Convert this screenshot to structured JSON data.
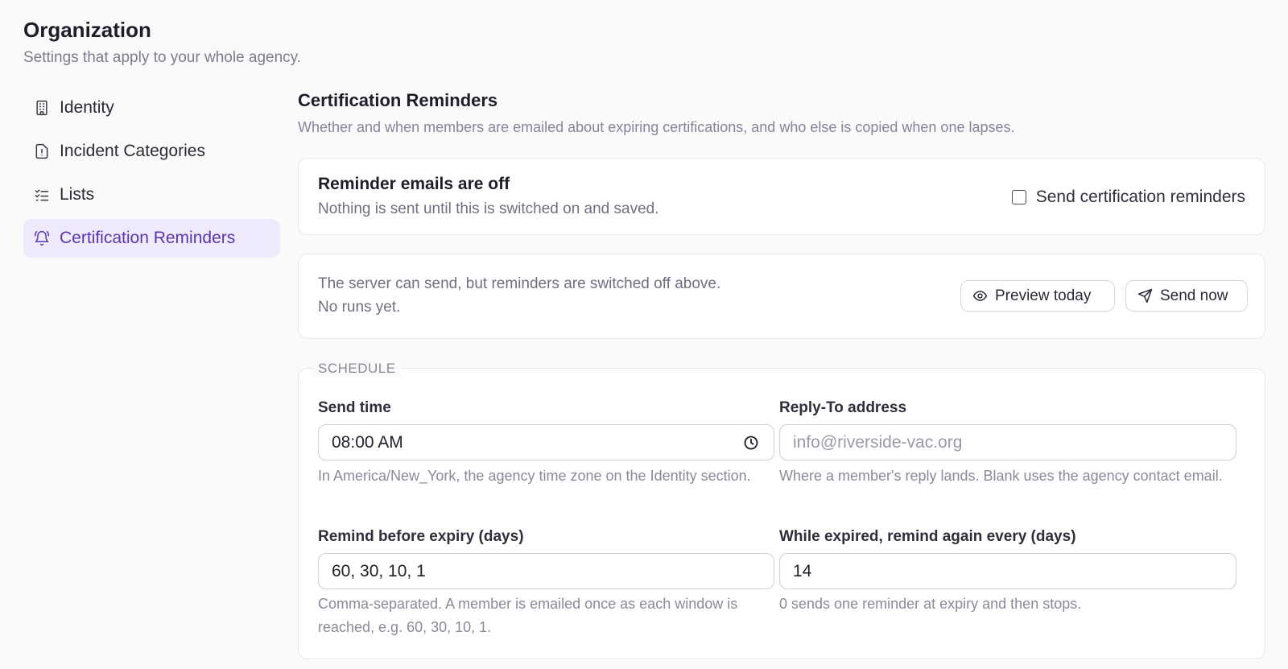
{
  "header": {
    "title": "Organization",
    "subtitle": "Settings that apply to your whole agency."
  },
  "sidebar": {
    "items": [
      {
        "label": "Identity",
        "icon": "building-icon",
        "active": false
      },
      {
        "label": "Incident Categories",
        "icon": "file-alert-icon",
        "active": false
      },
      {
        "label": "Lists",
        "icon": "list-checks-icon",
        "active": false
      },
      {
        "label": "Certification Reminders",
        "icon": "bell-ring-icon",
        "active": true
      }
    ]
  },
  "section": {
    "title": "Certification Reminders",
    "description": "Whether and when members are emailed about expiring certifications, and who else is copied when one lapses."
  },
  "status_card": {
    "title": "Reminder emails are off",
    "description": "Nothing is sent until this is switched on and saved.",
    "toggle_label": "Send certification reminders",
    "toggle_checked": false
  },
  "run_card": {
    "line1": "The server can send, but reminders are switched off above.",
    "line2": "No runs yet.",
    "preview_label": "Preview today",
    "send_label": "Send now"
  },
  "schedule": {
    "legend": "SCHEDULE",
    "send_time": {
      "label": "Send time",
      "value": "08:00 AM",
      "hint": "In America/New_York, the agency time zone on the Identity section."
    },
    "reply_to": {
      "label": "Reply-To address",
      "value": "",
      "placeholder": "info@riverside-vac.org",
      "hint": "Where a member's reply lands. Blank uses the agency contact email."
    },
    "remind_before": {
      "label": "Remind before expiry (days)",
      "value": "60, 30, 10, 1",
      "hint": "Comma-separated. A member is emailed once as each window is reached, e.g. 60, 30, 10, 1."
    },
    "remind_every": {
      "label": "While expired, remind again every (days)",
      "value": "14",
      "hint": "0 sends one reminder at expiry and then stops."
    }
  },
  "colors": {
    "accent": "#5b36b0",
    "active_bg": "#eee9fb",
    "page_bg": "#fafafb"
  }
}
